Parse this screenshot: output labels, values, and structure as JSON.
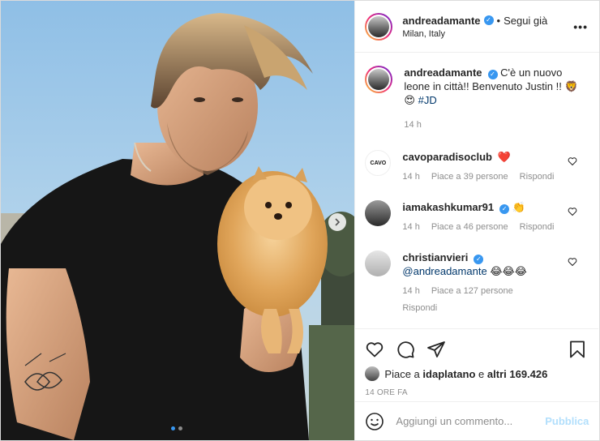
{
  "post": {
    "author": "andreadamante",
    "follow_separator": "•",
    "follow_label": "Segui già",
    "location": "Milan, Italy",
    "more_label": "•••",
    "carousel": {
      "total": 2,
      "active": 1
    }
  },
  "caption": {
    "username": "andreadamante",
    "text_line": "C'è un nuovo leone in città!! Benvenuto Justin !!",
    "emoji_lion": "🦁",
    "emoji_heart_eyes": "😍",
    "hashtag": "#JD",
    "time": "14 h"
  },
  "comments": [
    {
      "username": "cavoparadisoclub",
      "verified": false,
      "text": "",
      "emoji": "❤️",
      "time": "14 h",
      "likes": "Piace a 39 persone",
      "reply": "Rispondi",
      "avatar_text": "CAVO"
    },
    {
      "username": "iamakashkumar91",
      "verified": true,
      "text": "",
      "emoji": "👏",
      "time": "14 h",
      "likes": "Piace a 46 persone",
      "reply": "Rispondi"
    },
    {
      "username": "christianvieri",
      "verified": true,
      "text": "@andreadamante",
      "emoji": "😂😂😂",
      "time": "14 h",
      "likes": "Piace a 127 persone",
      "reply": "Rispondi"
    }
  ],
  "likes_bar": {
    "prefix": "Piace a",
    "user": "idaplatano",
    "middle": "e",
    "others": "altri 169.426"
  },
  "timestamp": "14 ORE FA",
  "add_comment": {
    "placeholder": "Aggiungi un commento...",
    "publish": "Pubblica"
  },
  "colors": {
    "verified_blue": "#3897f0",
    "link_blue": "#00376b",
    "publish_disabled": "#b2dffc",
    "muted": "#8e8e8e",
    "heart_red": "#ed4956"
  },
  "icons": [
    "verified-icon",
    "more-options-icon",
    "heart-icon",
    "comment-icon",
    "share-icon",
    "save-icon",
    "emoji-icon",
    "chevron-right-icon"
  ]
}
